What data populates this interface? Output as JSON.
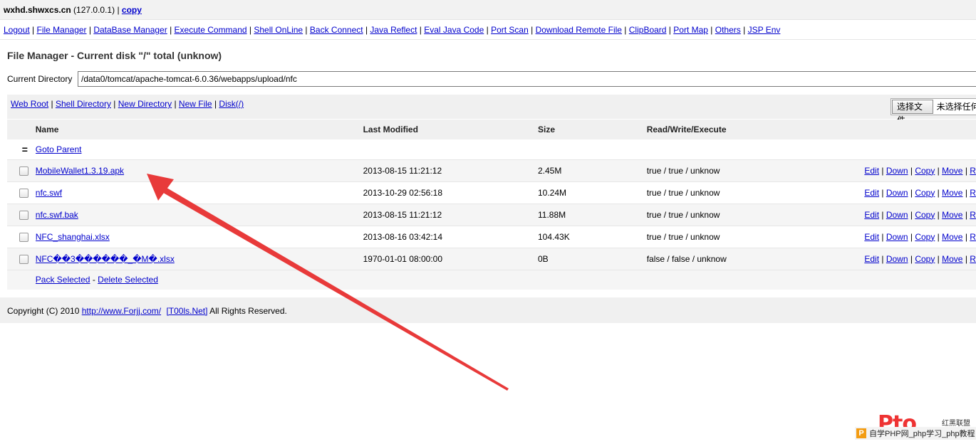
{
  "topbar": {
    "host": "wxhd.shwxcs.cn",
    "ip": "(127.0.0.1)",
    "copy_link": "copy"
  },
  "nav": {
    "items": [
      "Logout",
      "File Manager",
      "DataBase Manager",
      "Execute Command",
      "Shell OnLine",
      "Back Connect",
      "Java Reflect",
      "Eval Java Code",
      "Port Scan",
      "Download Remote File",
      "ClipBoard",
      "Port Map",
      "Others",
      "JSP Env"
    ]
  },
  "file_manager": {
    "title": "File Manager - Current disk \"/\" total (unknow)",
    "current_dir_label": "Current Directory",
    "current_dir_value": "/data0/tomcat/apache-tomcat-6.0.36/webapps/upload/nfc",
    "links": [
      "Web Root",
      "Shell Directory",
      "New Directory",
      "New File",
      "Disk(/)"
    ],
    "file_button": "选择文件",
    "file_status": "未选择任何文件"
  },
  "table": {
    "headers": {
      "name": "Name",
      "modified": "Last Modified",
      "size": "Size",
      "rwx": "Read/Write/Execute"
    },
    "parent_icon": "=",
    "parent_link": "Goto Parent",
    "rows": [
      {
        "name": "MobileWallet1.3.19.apk",
        "modified": "2013-08-15 11:21:12",
        "size": "2.45M",
        "rwx": "true / true / unknow"
      },
      {
        "name": "nfc.swf",
        "modified": "2013-10-29 02:56:18",
        "size": "10.24M",
        "rwx": "true / true / unknow"
      },
      {
        "name": "nfc.swf.bak",
        "modified": "2013-08-15 11:21:12",
        "size": "11.88M",
        "rwx": "true / true / unknow"
      },
      {
        "name": "NFC_shanghai.xlsx",
        "modified": "2013-08-16 03:42:14",
        "size": "104.43K",
        "rwx": "true / true / unknow"
      },
      {
        "name": "NFC��3������_�M�.xlsx",
        "modified": "1970-01-01 08:00:00",
        "size": "0B",
        "rwx": "false / false / unknow"
      }
    ],
    "actions": {
      "edit": "Edit",
      "down": "Down",
      "copy": "Copy",
      "move": "Move",
      "more": "R"
    },
    "pack_selected": "Pack Selected",
    "delete_selected": "Delete Selected"
  },
  "footer": {
    "prefix": "Copyright (C) 2010",
    "link1": "http://www.Forjj.com/",
    "link2": "[T00ls.Net]",
    "suffix": "All Rights Reserved."
  },
  "watermark": {
    "logo": "Pto",
    "logo_text": "红黑联盟",
    "strip_icon": "P",
    "strip_text": "自学PHP网_php学习_php教程"
  },
  "colors": {
    "link": "#0000cc",
    "arrow": "#e83a3a",
    "header_bg": "#f0f0f0"
  }
}
